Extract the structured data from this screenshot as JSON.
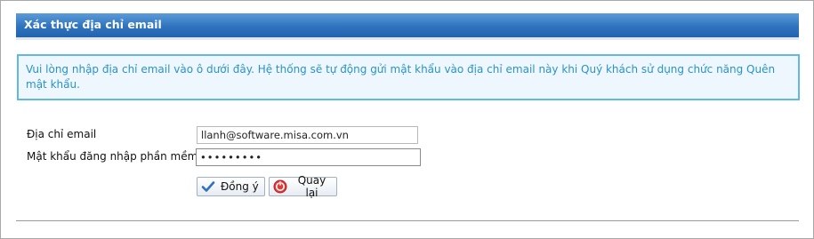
{
  "section": {
    "title": "Xác thực địa chỉ email"
  },
  "info": {
    "text": "Vui lòng nhập địa chỉ email vào ô dưới đây. Hệ thống sẽ tự động gửi mật khẩu vào địa chỉ email này khi Quý khách sử dụng chức năng Quên mật khẩu."
  },
  "form": {
    "email_label": "Địa chỉ email",
    "email_value": "llanh@software.misa.com.vn",
    "password_label": "Mật khẩu đăng nhập phần mềm",
    "password_value": "•••••••••"
  },
  "buttons": {
    "ok_label": "Đồng ý",
    "ok_icon": "checkmark-icon",
    "back_label": "Quay lại",
    "back_icon": "back-circle-icon"
  },
  "colors": {
    "title_bar": "#2f73be",
    "info_border": "#61b8e6",
    "info_text": "#2a92c9"
  }
}
